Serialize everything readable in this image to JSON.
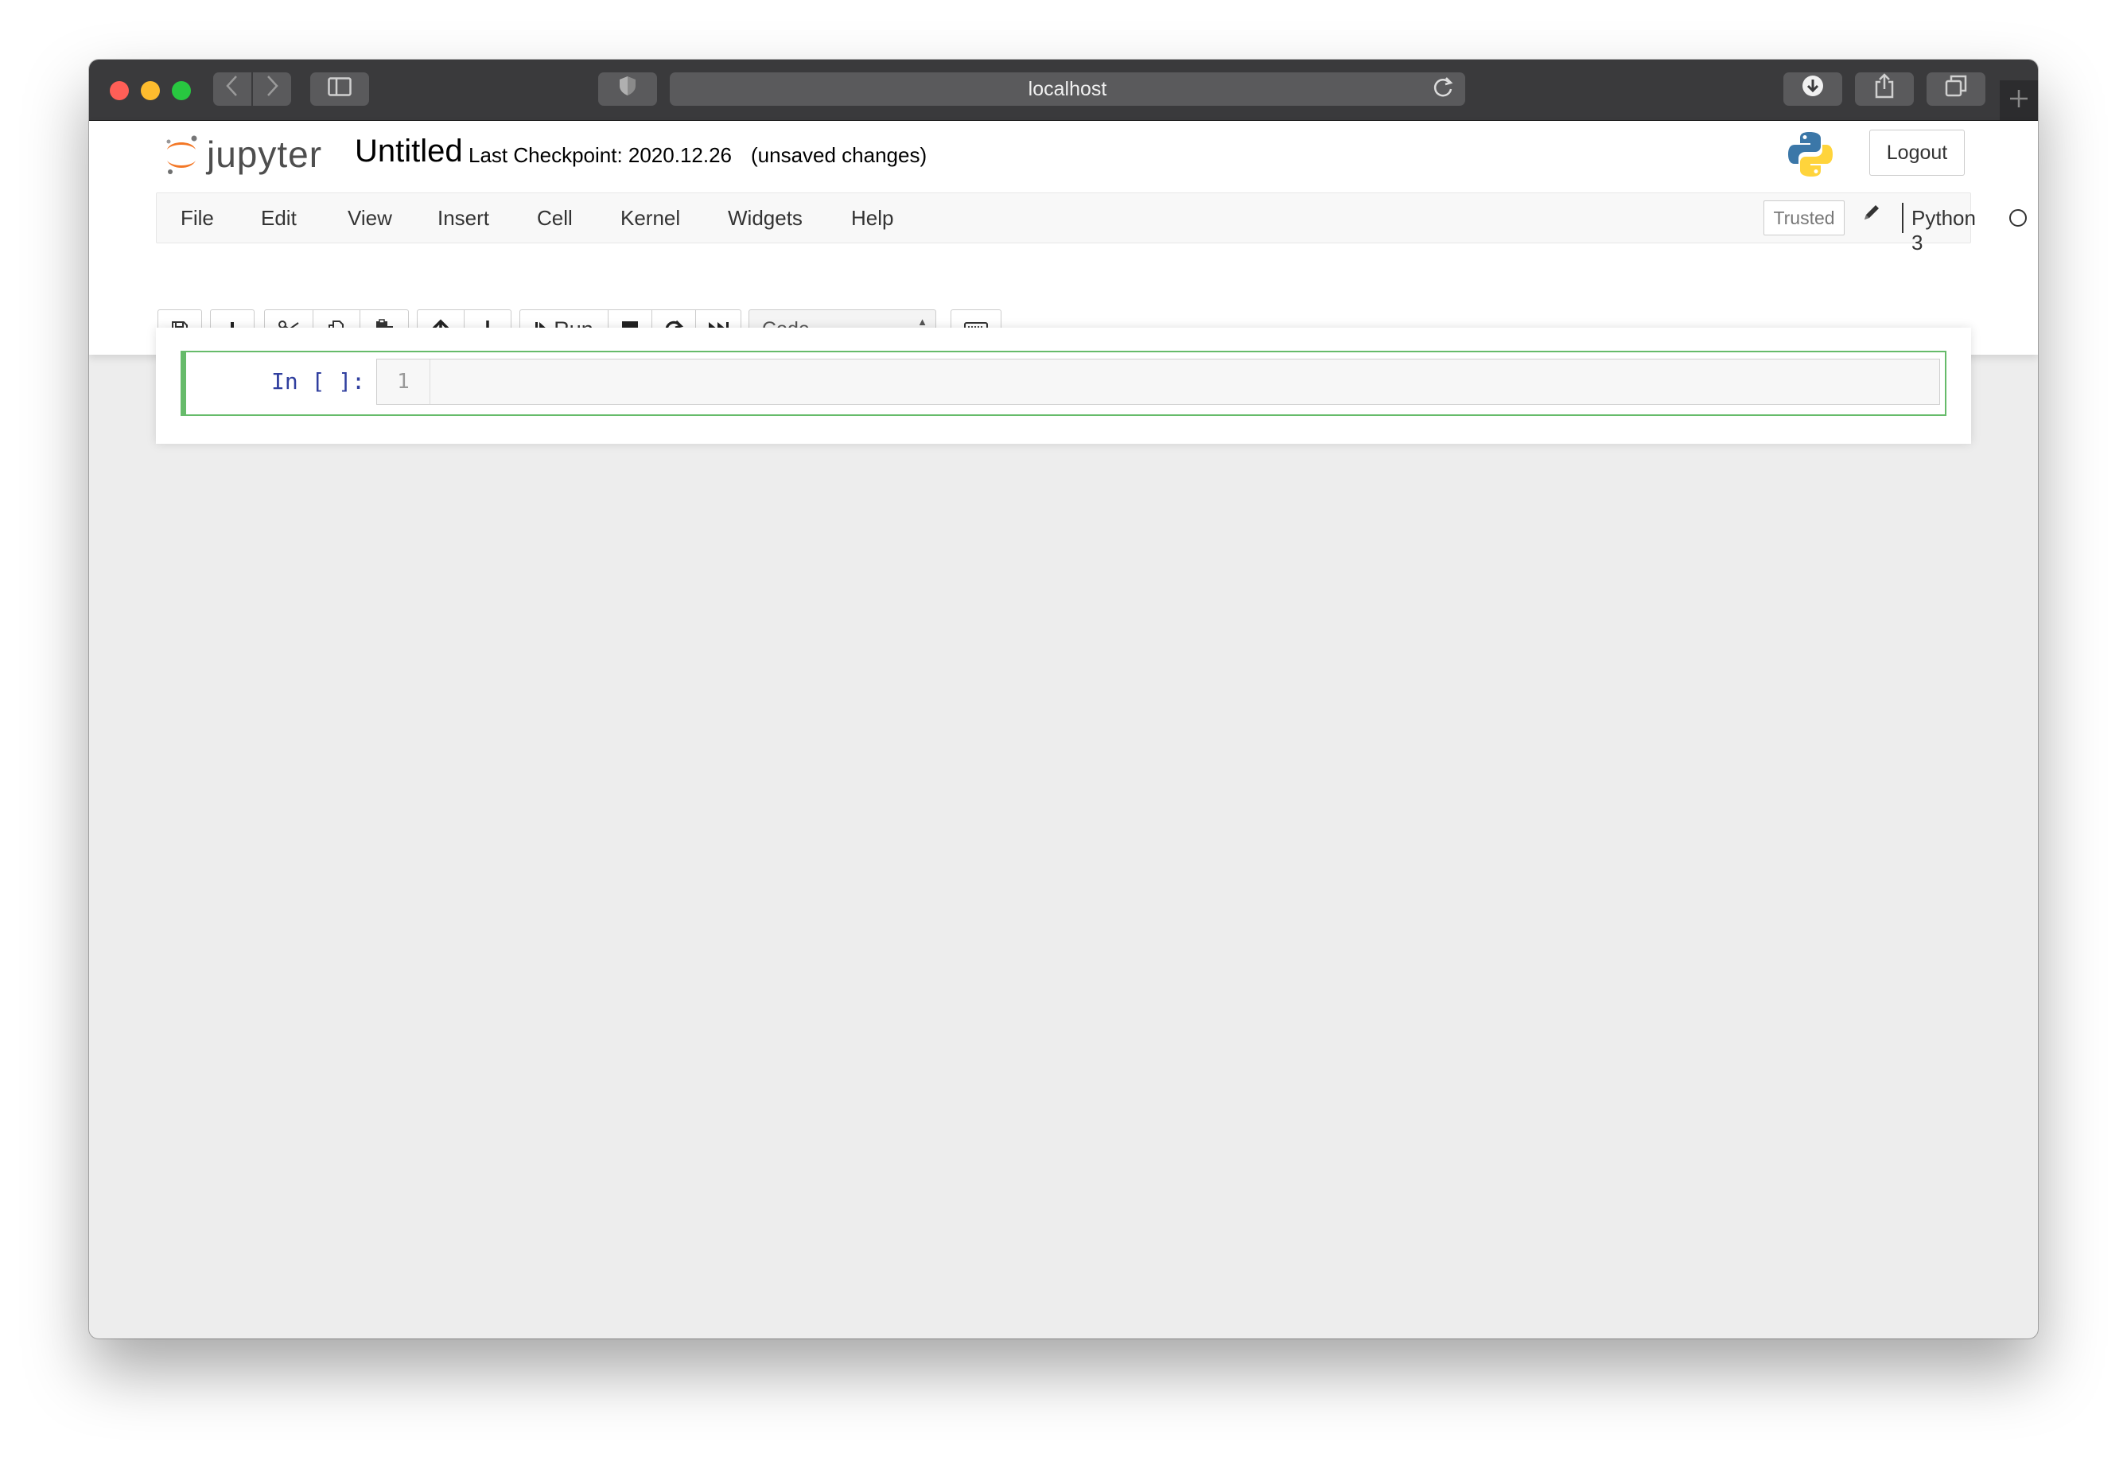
{
  "browser": {
    "url": "localhost",
    "icons": {
      "back": "chevron-left-icon",
      "forward": "chevron-right-icon",
      "sidebar": "sidebar-icon",
      "shield": "shield-icon",
      "reload": "reload-icon",
      "download": "download-icon",
      "share": "share-icon",
      "tabs": "tabs-icon",
      "new_tab": "plus-icon"
    }
  },
  "header": {
    "logo_text": "jupyter",
    "notebook_title": "Untitled",
    "checkpoint": "Last Checkpoint: 2020.12.26",
    "unsaved": "(unsaved changes)",
    "logout_label": "Logout"
  },
  "menubar": {
    "items": [
      "File",
      "Edit",
      "View",
      "Insert",
      "Cell",
      "Kernel",
      "Widgets",
      "Help"
    ],
    "trusted": "Trusted",
    "kernel_name": "Python 3"
  },
  "toolbar": {
    "run_label": "Run",
    "cell_type": "Code"
  },
  "cell": {
    "prompt": "In [ ]:",
    "line_number": "1"
  },
  "colors": {
    "cell_selected_border": "#66bb6a",
    "prompt_color": "#303f9f",
    "jupyter_orange": "#f37726"
  }
}
